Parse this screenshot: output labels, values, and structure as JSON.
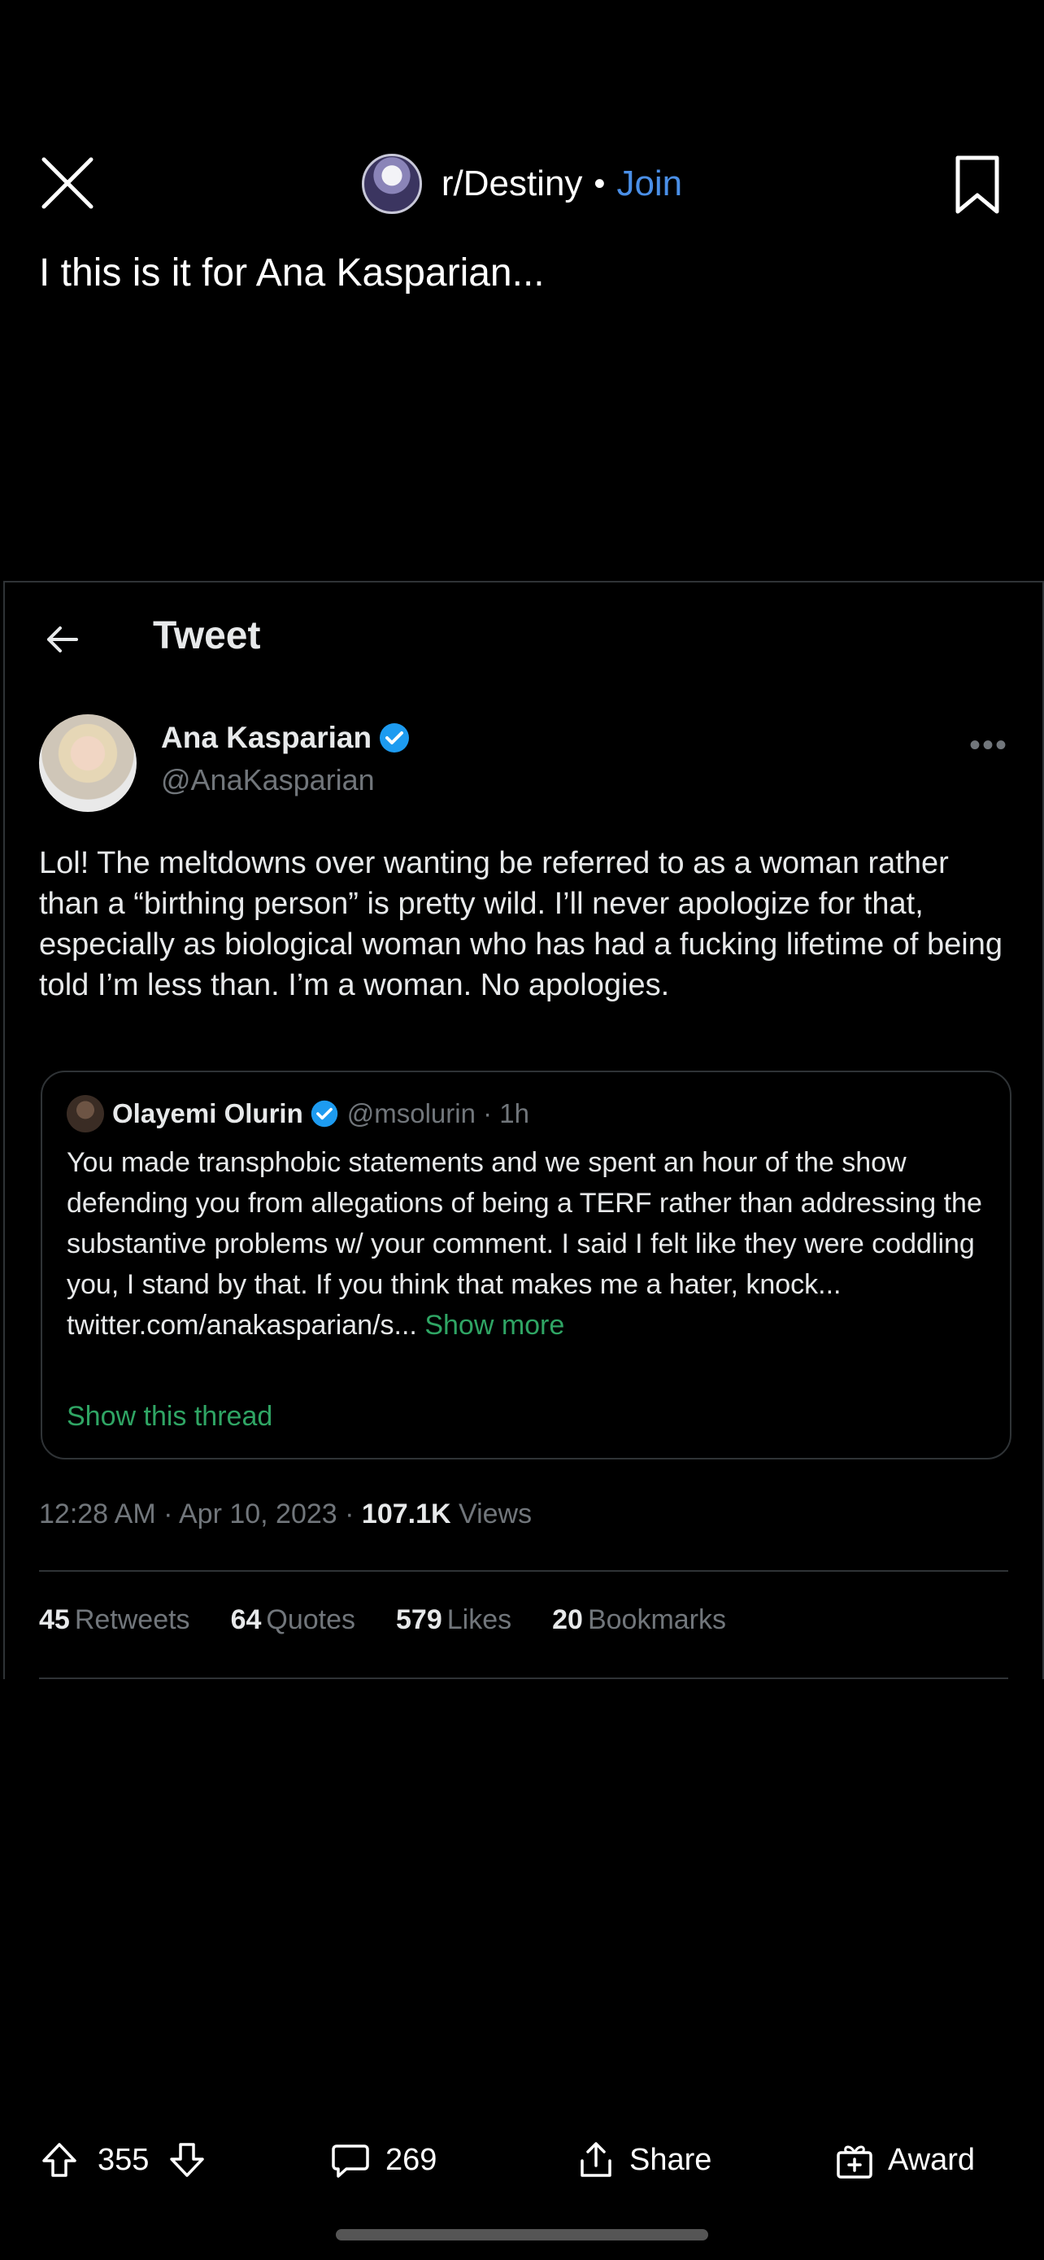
{
  "header": {
    "subreddit": "r/Destiny",
    "separator": "•",
    "join_label": "Join"
  },
  "post": {
    "title": "I this is it for Ana Kasparian..."
  },
  "tweet": {
    "header_title": "Tweet",
    "author_name": "Ana Kasparian",
    "author_handle": "@AnaKasparian",
    "text": "Lol! The meltdowns over wanting be referred to as a woman rather than a “birthing person” is pretty wild. I’ll never apologize for that, especially as biological woman who has had a fucking lifetime of being told I’m less than. I’m a woman. No apologies.",
    "quote": {
      "name": "Olayemi Olurin",
      "handle_time": "@msolurin · 1h",
      "text": "You made transphobic statements and we spent an hour of the show defending you from allegations of being a TERF rather than addressing the substantive problems w/ your comment. I said I felt like they were coddling you, I stand by that. If you think that makes me a hater, knock... twitter.com/anakasparian/s...",
      "show_more": "Show more",
      "show_thread": "Show this thread"
    },
    "meta": {
      "timestamp": "12:28 AM · Apr 10, 2023 · ",
      "views_count": "107.1K",
      "views_label": " Views"
    },
    "stats": [
      {
        "count": "45",
        "label": "Retweets"
      },
      {
        "count": "64",
        "label": "Quotes"
      },
      {
        "count": "579",
        "label": "Likes"
      },
      {
        "count": "20",
        "label": "Bookmarks"
      }
    ]
  },
  "actions": {
    "votes": "355",
    "comments": "269",
    "share_label": "Share",
    "award_label": "Award"
  },
  "colors": {
    "background": "#000000",
    "join_blue": "#4a8fe7",
    "verified_blue": "#1d9bf0",
    "link_green": "#2fa564",
    "muted_gray": "#71767b"
  }
}
